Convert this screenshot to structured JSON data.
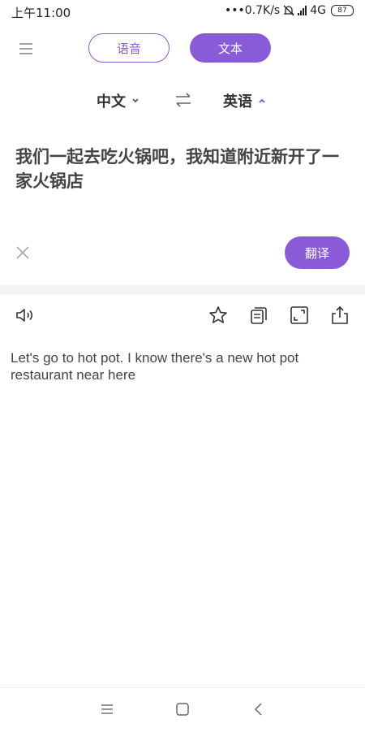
{
  "status_bar": {
    "time": "上午11:00",
    "network_speed": "•••0.7K/s",
    "network_type": "4G",
    "battery": "87"
  },
  "header": {
    "voice_label": "语音",
    "text_label": "文本"
  },
  "languages": {
    "source": "中文",
    "target": "英语"
  },
  "input": {
    "text": "我们一起去吃火锅吧，我知道附近新开了一家火锅店"
  },
  "actions": {
    "translate_label": "翻译"
  },
  "result": {
    "text": "Let's go to hot pot. I know there's a new hot pot restaurant near here"
  },
  "colors": {
    "accent": "#8a5bd6",
    "band": "#f4f4f7"
  },
  "icons": [
    "menu-icon",
    "swap-icon",
    "chevron-down-icon",
    "chevron-up-icon",
    "close-icon",
    "speaker-icon",
    "star-icon",
    "copy-icon",
    "expand-icon",
    "share-icon"
  ]
}
